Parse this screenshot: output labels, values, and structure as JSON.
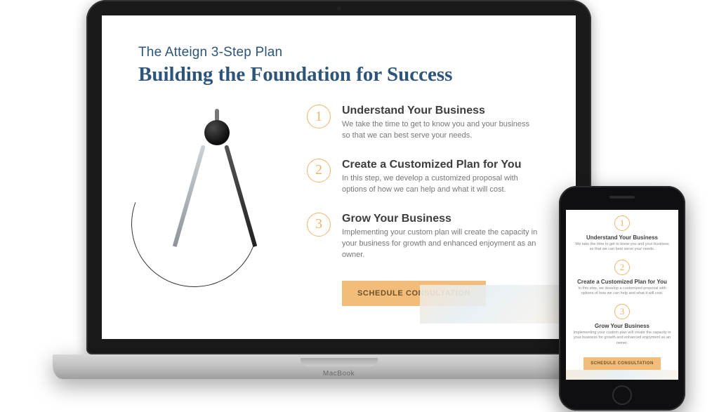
{
  "device": {
    "laptop_brand": "MacBook"
  },
  "colors": {
    "accent": "#efb46a",
    "brand_blue": "#2d547a",
    "cta_bg": "#f2bd7a"
  },
  "header": {
    "eyebrow": "The Atteign 3-Step Plan",
    "headline": "Building the Foundation for Success"
  },
  "steps": [
    {
      "num": "1",
      "title": "Understand Your Business",
      "desc_desktop": "We take the time to get to know you and your business so that we can best serve your needs.",
      "desc_mobile": "We take the time to get to know you and your business so that we can best serve your needs."
    },
    {
      "num": "2",
      "title": "Create a Customized Plan for You",
      "desc_desktop": "In this step, we develop a customized proposal with options of how we can help and what it will cost.",
      "desc_mobile": "In this step, we develop a customized proposal with options of how we can help and what it will cost."
    },
    {
      "num": "3",
      "title": "Grow Your Business",
      "desc_desktop": "Implementing your custom plan will create the capacity in your business for growth and enhanced enjoyment as an owner.",
      "desc_mobile": "Implementing your custom plan will create the capacity in your business for growth and enhanced enjoyment as an owner."
    }
  ],
  "cta": {
    "label": "SCHEDULE CONSULTATION"
  }
}
